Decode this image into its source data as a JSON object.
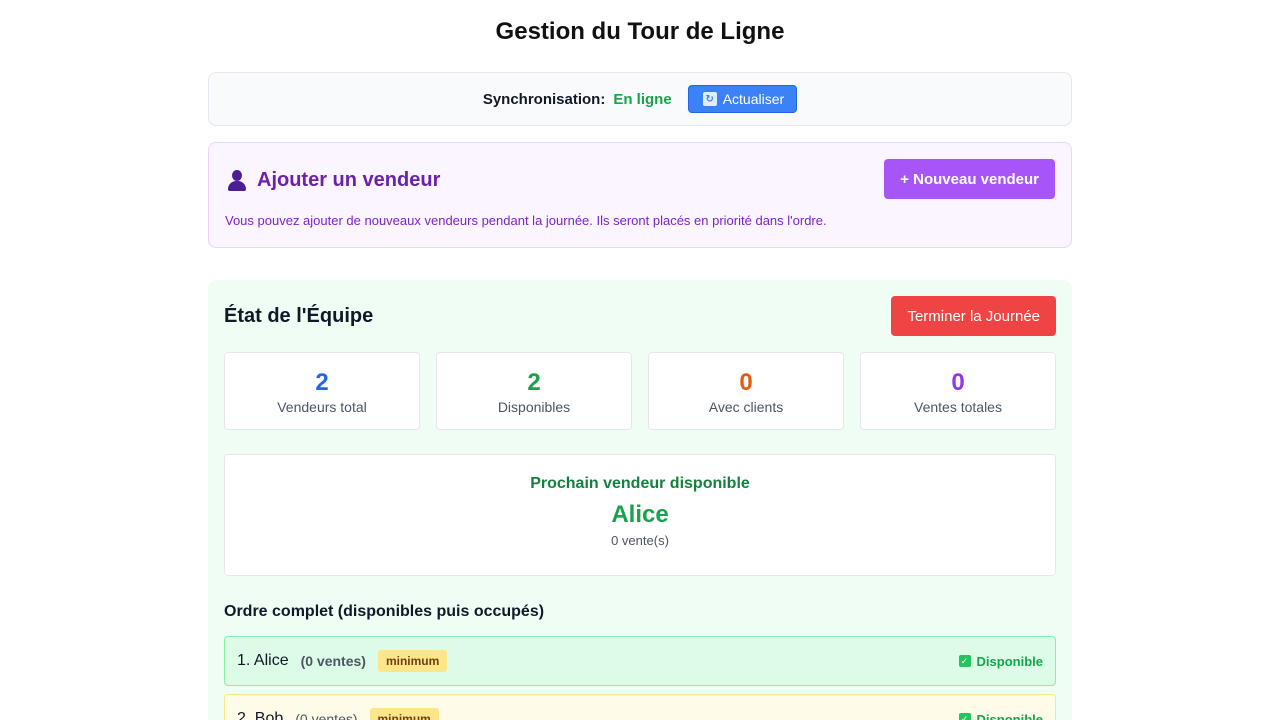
{
  "header": {
    "title": "Gestion du Tour de Ligne"
  },
  "sync": {
    "label": "Synchronisation:",
    "status": "En ligne",
    "refresh_label": "Actualiser",
    "refresh_icon": "refresh-icon"
  },
  "add_seller": {
    "title": "Ajouter un vendeur",
    "icon": "person-icon",
    "button_label": "+ Nouveau vendeur",
    "description": "Vous pouvez ajouter de nouveaux vendeurs pendant la journée. Ils seront placés en priorité dans l'ordre."
  },
  "team": {
    "title": "État de l'Équipe",
    "end_day_label": "Terminer la Journée",
    "stats": [
      {
        "value": "2",
        "label": "Vendeurs total",
        "color": "#2563eb"
      },
      {
        "value": "2",
        "label": "Disponibles",
        "color": "#16a34a"
      },
      {
        "value": "0",
        "label": "Avec clients",
        "color": "#ea580c"
      },
      {
        "value": "0",
        "label": "Ventes totales",
        "color": "#9333ea"
      }
    ],
    "next": {
      "title": "Prochain vendeur disponible",
      "name": "Alice",
      "sales": "0 vente(s)"
    },
    "order_title": "Ordre complet (disponibles puis occupés)",
    "order": [
      {
        "name": "1. Alice",
        "sales": "(0 ventes)",
        "badge": "minimum",
        "status": "Disponible"
      },
      {
        "name": "2. Bob",
        "sales": "(0 ventes)",
        "badge": "minimum",
        "status": "Disponible"
      }
    ]
  },
  "colors": {
    "accent_purple": "#a855f7",
    "accent_blue": "#3b82f6",
    "danger": "#ef4444",
    "success": "#16a34a"
  }
}
